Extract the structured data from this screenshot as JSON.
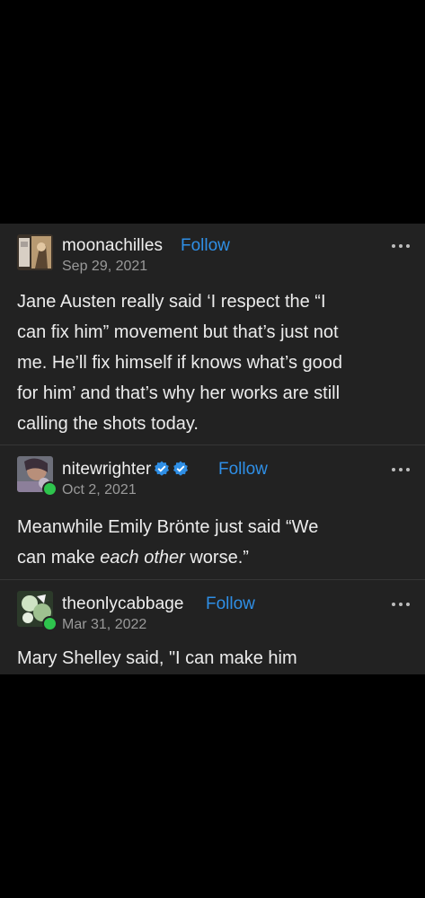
{
  "posts": [
    {
      "username": "moonachilles",
      "follow_label": "Follow",
      "date": "Sep 29, 2021",
      "body_lines": [
        "Jane Austen really said ‘I respect the “I",
        "can fix him” movement but that’s just not",
        "me. He’ll fix himself if knows what’s good",
        "for him’ and that’s why her works are still",
        "calling the shots today."
      ]
    },
    {
      "username": "nitewrighter",
      "follow_label": "Follow",
      "date": "Oct 2, 2021",
      "body_line1": "Meanwhile Emily Brönte just said “We",
      "body_line2_pre": "can make ",
      "body_line2_em": "each other",
      "body_line2_post": " worse.”"
    },
    {
      "username": "theonlycabbage",
      "follow_label": "Follow",
      "date": "Mar 31, 2022",
      "body_line1": "Mary Shelley said, \"I can make him"
    }
  ],
  "colors": {
    "background": "#000000",
    "panel": "#222222",
    "follow": "#2f8fe6",
    "badge": "#2ec44d",
    "verified": "#2f8fe6"
  }
}
